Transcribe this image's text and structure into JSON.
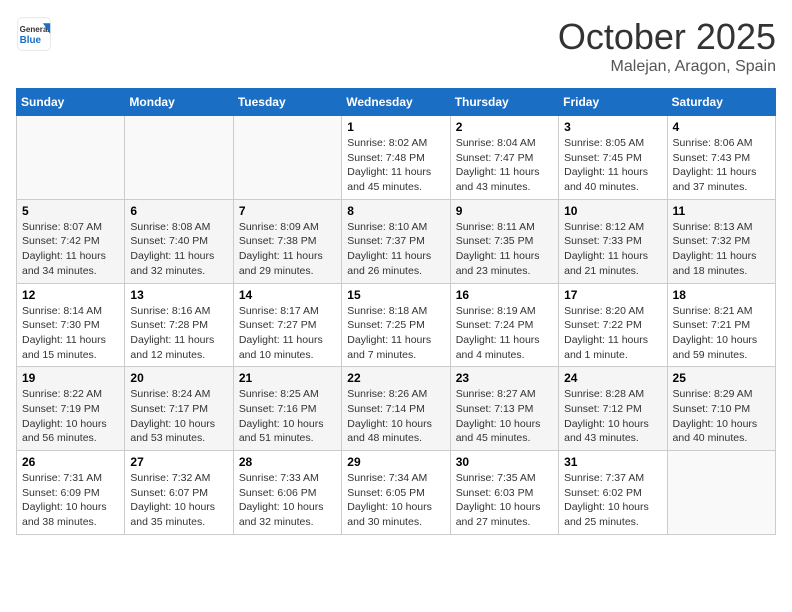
{
  "header": {
    "logo_general": "General",
    "logo_blue": "Blue",
    "month": "October 2025",
    "location": "Malejan, Aragon, Spain"
  },
  "weekdays": [
    "Sunday",
    "Monday",
    "Tuesday",
    "Wednesday",
    "Thursday",
    "Friday",
    "Saturday"
  ],
  "weeks": [
    [
      {
        "day": "",
        "info": ""
      },
      {
        "day": "",
        "info": ""
      },
      {
        "day": "",
        "info": ""
      },
      {
        "day": "1",
        "info": "Sunrise: 8:02 AM\nSunset: 7:48 PM\nDaylight: 11 hours and 45 minutes."
      },
      {
        "day": "2",
        "info": "Sunrise: 8:04 AM\nSunset: 7:47 PM\nDaylight: 11 hours and 43 minutes."
      },
      {
        "day": "3",
        "info": "Sunrise: 8:05 AM\nSunset: 7:45 PM\nDaylight: 11 hours and 40 minutes."
      },
      {
        "day": "4",
        "info": "Sunrise: 8:06 AM\nSunset: 7:43 PM\nDaylight: 11 hours and 37 minutes."
      }
    ],
    [
      {
        "day": "5",
        "info": "Sunrise: 8:07 AM\nSunset: 7:42 PM\nDaylight: 11 hours and 34 minutes."
      },
      {
        "day": "6",
        "info": "Sunrise: 8:08 AM\nSunset: 7:40 PM\nDaylight: 11 hours and 32 minutes."
      },
      {
        "day": "7",
        "info": "Sunrise: 8:09 AM\nSunset: 7:38 PM\nDaylight: 11 hours and 29 minutes."
      },
      {
        "day": "8",
        "info": "Sunrise: 8:10 AM\nSunset: 7:37 PM\nDaylight: 11 hours and 26 minutes."
      },
      {
        "day": "9",
        "info": "Sunrise: 8:11 AM\nSunset: 7:35 PM\nDaylight: 11 hours and 23 minutes."
      },
      {
        "day": "10",
        "info": "Sunrise: 8:12 AM\nSunset: 7:33 PM\nDaylight: 11 hours and 21 minutes."
      },
      {
        "day": "11",
        "info": "Sunrise: 8:13 AM\nSunset: 7:32 PM\nDaylight: 11 hours and 18 minutes."
      }
    ],
    [
      {
        "day": "12",
        "info": "Sunrise: 8:14 AM\nSunset: 7:30 PM\nDaylight: 11 hours and 15 minutes."
      },
      {
        "day": "13",
        "info": "Sunrise: 8:16 AM\nSunset: 7:28 PM\nDaylight: 11 hours and 12 minutes."
      },
      {
        "day": "14",
        "info": "Sunrise: 8:17 AM\nSunset: 7:27 PM\nDaylight: 11 hours and 10 minutes."
      },
      {
        "day": "15",
        "info": "Sunrise: 8:18 AM\nSunset: 7:25 PM\nDaylight: 11 hours and 7 minutes."
      },
      {
        "day": "16",
        "info": "Sunrise: 8:19 AM\nSunset: 7:24 PM\nDaylight: 11 hours and 4 minutes."
      },
      {
        "day": "17",
        "info": "Sunrise: 8:20 AM\nSunset: 7:22 PM\nDaylight: 11 hours and 1 minute."
      },
      {
        "day": "18",
        "info": "Sunrise: 8:21 AM\nSunset: 7:21 PM\nDaylight: 10 hours and 59 minutes."
      }
    ],
    [
      {
        "day": "19",
        "info": "Sunrise: 8:22 AM\nSunset: 7:19 PM\nDaylight: 10 hours and 56 minutes."
      },
      {
        "day": "20",
        "info": "Sunrise: 8:24 AM\nSunset: 7:17 PM\nDaylight: 10 hours and 53 minutes."
      },
      {
        "day": "21",
        "info": "Sunrise: 8:25 AM\nSunset: 7:16 PM\nDaylight: 10 hours and 51 minutes."
      },
      {
        "day": "22",
        "info": "Sunrise: 8:26 AM\nSunset: 7:14 PM\nDaylight: 10 hours and 48 minutes."
      },
      {
        "day": "23",
        "info": "Sunrise: 8:27 AM\nSunset: 7:13 PM\nDaylight: 10 hours and 45 minutes."
      },
      {
        "day": "24",
        "info": "Sunrise: 8:28 AM\nSunset: 7:12 PM\nDaylight: 10 hours and 43 minutes."
      },
      {
        "day": "25",
        "info": "Sunrise: 8:29 AM\nSunset: 7:10 PM\nDaylight: 10 hours and 40 minutes."
      }
    ],
    [
      {
        "day": "26",
        "info": "Sunrise: 7:31 AM\nSunset: 6:09 PM\nDaylight: 10 hours and 38 minutes."
      },
      {
        "day": "27",
        "info": "Sunrise: 7:32 AM\nSunset: 6:07 PM\nDaylight: 10 hours and 35 minutes."
      },
      {
        "day": "28",
        "info": "Sunrise: 7:33 AM\nSunset: 6:06 PM\nDaylight: 10 hours and 32 minutes."
      },
      {
        "day": "29",
        "info": "Sunrise: 7:34 AM\nSunset: 6:05 PM\nDaylight: 10 hours and 30 minutes."
      },
      {
        "day": "30",
        "info": "Sunrise: 7:35 AM\nSunset: 6:03 PM\nDaylight: 10 hours and 27 minutes."
      },
      {
        "day": "31",
        "info": "Sunrise: 7:37 AM\nSunset: 6:02 PM\nDaylight: 10 hours and 25 minutes."
      },
      {
        "day": "",
        "info": ""
      }
    ]
  ]
}
